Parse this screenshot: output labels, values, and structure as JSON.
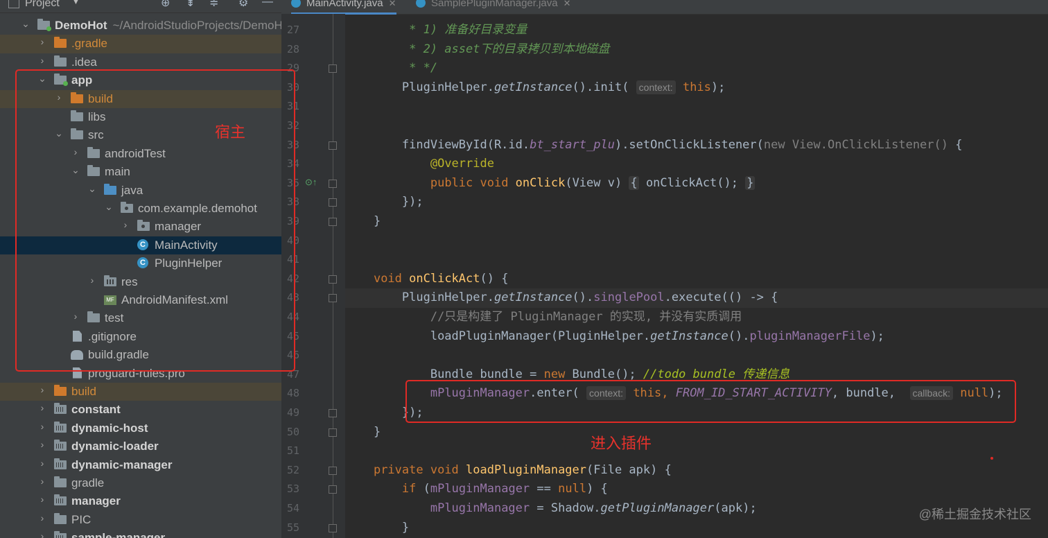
{
  "project_panel": {
    "title": "Project",
    "header_icons": [
      "target-icon",
      "collapse-all-icon",
      "expand-icon",
      "gear-icon",
      "minimize-icon"
    ],
    "items": [
      {
        "label": "DemoHot",
        "suffix": "~/AndroidStudioProjects/DemoHot",
        "depth": 0,
        "expanded": true,
        "icon": "module-folder-icon",
        "bold": true
      },
      {
        "label": ".gradle",
        "depth": 1,
        "expanded": false,
        "icon": "excluded-folder-icon",
        "excluded": true
      },
      {
        "label": ".idea",
        "depth": 1,
        "expanded": false,
        "icon": "folder-icon"
      },
      {
        "label": "app",
        "depth": 1,
        "expanded": true,
        "icon": "module-folder-icon",
        "bold": true
      },
      {
        "label": "build",
        "depth": 2,
        "expanded": false,
        "icon": "excluded-folder-icon",
        "excluded": true
      },
      {
        "label": "libs",
        "depth": 2,
        "icon": "folder-icon"
      },
      {
        "label": "src",
        "depth": 2,
        "expanded": true,
        "icon": "folder-icon"
      },
      {
        "label": "androidTest",
        "depth": 3,
        "expanded": false,
        "icon": "folder-icon"
      },
      {
        "label": "main",
        "depth": 3,
        "expanded": true,
        "icon": "folder-icon"
      },
      {
        "label": "java",
        "depth": 4,
        "expanded": true,
        "icon": "source-folder-icon"
      },
      {
        "label": "com.example.demohot",
        "depth": 5,
        "expanded": true,
        "icon": "package-icon"
      },
      {
        "label": "manager",
        "depth": 6,
        "expanded": false,
        "icon": "package-icon"
      },
      {
        "label": "MainActivity",
        "depth": 6,
        "icon": "class-icon",
        "selected": true
      },
      {
        "label": "PluginHelper",
        "depth": 6,
        "icon": "class-icon"
      },
      {
        "label": "res",
        "depth": 4,
        "expanded": false,
        "icon": "resource-folder-icon"
      },
      {
        "label": "AndroidManifest.xml",
        "depth": 4,
        "icon": "manifest-icon"
      },
      {
        "label": "test",
        "depth": 3,
        "expanded": false,
        "icon": "folder-icon"
      },
      {
        "label": ".gitignore",
        "depth": 2,
        "icon": "gitignore-file-icon"
      },
      {
        "label": "build.gradle",
        "depth": 2,
        "icon": "gradle-file-icon"
      },
      {
        "label": "proguard-rules.pro",
        "depth": 2,
        "icon": "file-icon"
      },
      {
        "label": "build",
        "depth": 1,
        "expanded": false,
        "icon": "excluded-folder-icon",
        "excluded": true
      },
      {
        "label": "constant",
        "depth": 1,
        "expanded": false,
        "icon": "library-module-icon",
        "bold": true
      },
      {
        "label": "dynamic-host",
        "depth": 1,
        "expanded": false,
        "icon": "library-module-icon",
        "bold": true
      },
      {
        "label": "dynamic-loader",
        "depth": 1,
        "expanded": false,
        "icon": "library-module-icon",
        "bold": true
      },
      {
        "label": "dynamic-manager",
        "depth": 1,
        "expanded": false,
        "icon": "library-module-icon",
        "bold": true
      },
      {
        "label": "gradle",
        "depth": 1,
        "expanded": false,
        "icon": "folder-icon"
      },
      {
        "label": "manager",
        "depth": 1,
        "expanded": false,
        "icon": "library-module-icon",
        "bold": true
      },
      {
        "label": "PIC",
        "depth": 1,
        "expanded": false,
        "icon": "folder-icon"
      },
      {
        "label": "sample-manager",
        "depth": 1,
        "expanded": false,
        "icon": "library-module-icon",
        "bold": true
      }
    ]
  },
  "editor": {
    "tabs": [
      {
        "label": "MainActivity.java",
        "active": true
      },
      {
        "label": "SamplePluginManager.java",
        "active": false
      }
    ],
    "current_line": "43",
    "lines": [
      {
        "n": "27",
        "segs": [
          {
            "t": "     * 1) 准备好目录变量",
            "c": "dc"
          }
        ]
      },
      {
        "n": "28",
        "segs": [
          {
            "t": "     * 2) asset下的目录拷贝到本地磁盘",
            "c": "dc"
          }
        ]
      },
      {
        "n": "29",
        "segs": [
          {
            "t": "     * */",
            "c": "dc"
          }
        ],
        "fold": true
      },
      {
        "n": "30",
        "segs": [
          {
            "t": "    PluginHelper."
          },
          {
            "t": "getInstance",
            "c": "it"
          },
          {
            "t": "().init( "
          },
          {
            "t": "context:",
            "c": "hint"
          },
          {
            "t": " "
          },
          {
            "t": "this",
            "c": "k"
          },
          {
            "t": ");"
          }
        ]
      },
      {
        "n": "31",
        "segs": []
      },
      {
        "n": "32",
        "segs": []
      },
      {
        "n": "33",
        "segs": [
          {
            "t": "    findViewById(R.id."
          },
          {
            "t": "bt_start_plu",
            "c": "st"
          },
          {
            "t": ").setOnClickListener("
          },
          {
            "t": "new View.OnClickListener() ",
            "c": "cm"
          },
          {
            "t": "{"
          }
        ],
        "fold": true
      },
      {
        "n": "34",
        "segs": [
          {
            "t": "        "
          },
          {
            "t": "@Override",
            "c": "an"
          }
        ]
      },
      {
        "n": "35",
        "segs": [
          {
            "t": "        "
          },
          {
            "t": "public void ",
            "c": "k"
          },
          {
            "t": "onClick",
            "c": "fn"
          },
          {
            "t": "(View v) "
          },
          {
            "t": "{",
            "c": "hint-dim"
          },
          {
            "t": " onClickAct(); "
          },
          {
            "t": "}",
            "c": "hint-dim"
          }
        ],
        "fold": true,
        "override": true
      },
      {
        "n": "38",
        "segs": [
          {
            "t": "    });"
          }
        ],
        "fold": true
      },
      {
        "n": "39",
        "segs": [
          {
            "t": "}"
          }
        ],
        "fold": true
      },
      {
        "n": "40",
        "segs": []
      },
      {
        "n": "41",
        "segs": []
      },
      {
        "n": "42",
        "segs": [
          {
            "t": "void ",
            "c": "k"
          },
          {
            "t": "onClickAct",
            "c": "fn"
          },
          {
            "t": "() {"
          }
        ],
        "fold": true
      },
      {
        "n": "43",
        "segs": [
          {
            "t": "    PluginHelper."
          },
          {
            "t": "getInstance",
            "c": "it"
          },
          {
            "t": "()."
          },
          {
            "t": "singlePool",
            "c": "fld"
          },
          {
            "t": ".execute(() -> {"
          }
        ],
        "fold": true,
        "bulb": true
      },
      {
        "n": "44",
        "segs": [
          {
            "t": "        //只是构建了 PluginManager 的实现, 并没有实质调用",
            "c": "cm"
          }
        ]
      },
      {
        "n": "45",
        "segs": [
          {
            "t": "        loadPluginManager(PluginHelper."
          },
          {
            "t": "getInstance",
            "c": "it"
          },
          {
            "t": "()."
          },
          {
            "t": "pluginManagerFile",
            "c": "fld"
          },
          {
            "t": ");"
          }
        ]
      },
      {
        "n": "46",
        "segs": []
      },
      {
        "n": "47",
        "segs": [
          {
            "t": "        Bundle bundle = "
          },
          {
            "t": "new ",
            "c": "k"
          },
          {
            "t": "Bundle(); "
          },
          {
            "t": "//todo bundle 传递信息",
            "c": "todo"
          }
        ]
      },
      {
        "n": "48",
        "segs": [
          {
            "t": "        "
          },
          {
            "t": "mPluginManager",
            "c": "fld"
          },
          {
            "t": ".enter( "
          },
          {
            "t": "context:",
            "c": "hint"
          },
          {
            "t": " "
          },
          {
            "t": "this, ",
            "c": "k"
          },
          {
            "t": "FROM_ID_START_ACTIVITY",
            "c": "st"
          },
          {
            "t": ", bundle,  "
          },
          {
            "t": "callback:",
            "c": "hint"
          },
          {
            "t": " "
          },
          {
            "t": "null",
            "c": "k"
          },
          {
            "t": ");"
          }
        ]
      },
      {
        "n": "49",
        "segs": [
          {
            "t": "    });"
          }
        ],
        "fold": true
      },
      {
        "n": "50",
        "segs": [
          {
            "t": "}"
          }
        ],
        "fold": true
      },
      {
        "n": "51",
        "segs": []
      },
      {
        "n": "52",
        "segs": [
          {
            "t": "private void ",
            "c": "k"
          },
          {
            "t": "loadPluginManager",
            "c": "fn"
          },
          {
            "t": "(File apk) {"
          }
        ],
        "fold": true
      },
      {
        "n": "53",
        "segs": [
          {
            "t": "    "
          },
          {
            "t": "if ",
            "c": "k"
          },
          {
            "t": "("
          },
          {
            "t": "mPluginManager",
            "c": "fld"
          },
          {
            "t": " == "
          },
          {
            "t": "null",
            "c": "k"
          },
          {
            "t": ") {"
          }
        ],
        "fold": true
      },
      {
        "n": "54",
        "segs": [
          {
            "t": "        "
          },
          {
            "t": "mPluginManager",
            "c": "fld"
          },
          {
            "t": " = Shadow."
          },
          {
            "t": "getPluginManager",
            "c": "it"
          },
          {
            "t": "(apk);"
          }
        ]
      },
      {
        "n": "55",
        "segs": [
          {
            "t": "    }"
          }
        ],
        "fold": true
      }
    ]
  },
  "annotations": {
    "host_label": "宿主",
    "enter_plugin_label": "进入插件",
    "annotation_color": "#e02a25"
  },
  "watermark": "@稀土掘金技术社区",
  "colors": {
    "keyword": "#cc7832",
    "function": "#ffc66d",
    "field": "#9876aa",
    "comment": "#808080",
    "doc_comment": "#629755",
    "annotation": "#bbb529",
    "selection": "#0d293e"
  }
}
